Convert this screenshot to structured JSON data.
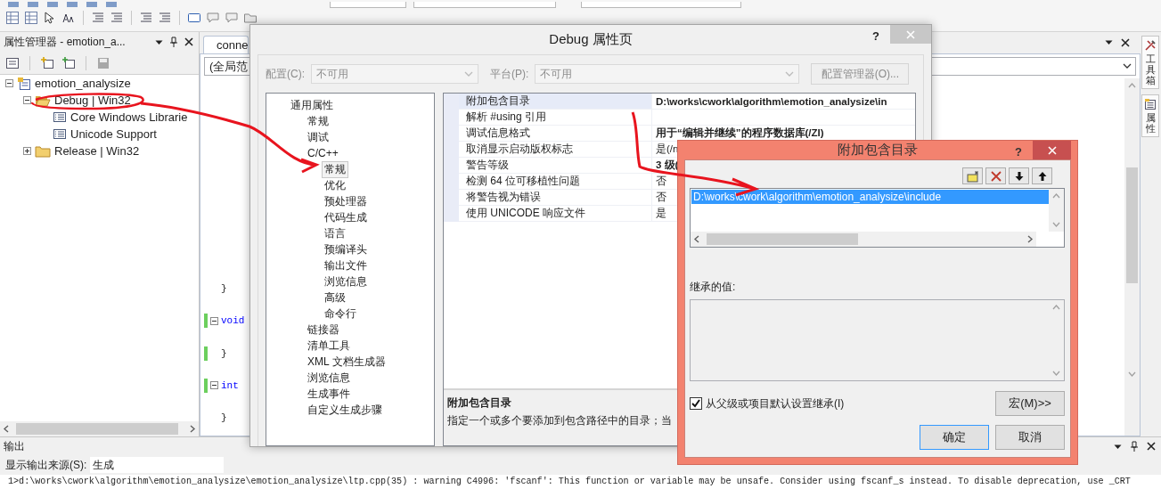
{
  "property_manager": {
    "title": "属性管理器 - emotion_a...",
    "tree": [
      {
        "label": "emotion_analysize",
        "kind": "project",
        "expanded": true,
        "children": [
          {
            "label": "Debug | Win32",
            "kind": "configuration",
            "expanded": true,
            "children": [
              {
                "label": "Core Windows Librarie",
                "kind": "sheet"
              },
              {
                "label": "Unicode Support",
                "kind": "sheet"
              }
            ]
          },
          {
            "label": "Release | Win32",
            "kind": "configuration",
            "expanded": false
          }
        ]
      }
    ]
  },
  "editor": {
    "tab": "conne",
    "scope": "(全局范",
    "code_lines": [
      {
        "text": "}",
        "kind": "brace",
        "modified": false
      },
      {
        "text": "void",
        "kind": "keyword",
        "modified": true
      },
      {
        "text": "}",
        "kind": "brace",
        "modified": true
      },
      {
        "text": "int",
        "kind": "keyword",
        "modified": true
      },
      {
        "text": "}",
        "kind": "brace",
        "modified": false
      }
    ]
  },
  "side_tabs": [
    {
      "label": "工具箱",
      "kind": "toolbox"
    },
    {
      "label": "属性",
      "kind": "properties"
    }
  ],
  "output": {
    "title": "输出",
    "source_label": "显示输出来源(S):",
    "source": "生成",
    "lines": [
      "1>d:\\works\\cwork\\algorithm\\emotion_analysize\\emotion_analysize\\ltp.cpp(35) : warning C4996: 'fscanf': This function or variable may be unsafe. Consider using fscanf_s instead. To disable deprecation, use _CRT"
    ]
  },
  "property_dialog": {
    "title": "Debug 属性页",
    "help": "?",
    "config_label": "配置(C):",
    "config": {
      "value": "不可用",
      "disabled": true
    },
    "platform_label": "平台(P):",
    "platform": {
      "value": "不可用",
      "disabled": true
    },
    "config_manager": {
      "label": "配置管理器(O)...",
      "disabled": true
    },
    "categories": [
      {
        "label": "通用属性",
        "selected": false,
        "children": [
          {
            "label": "常规",
            "selected": false
          },
          {
            "label": "调试",
            "selected": false
          },
          {
            "label": "C/C++",
            "selected": false,
            "children": [
              {
                "label": "常规",
                "selected": true
              },
              {
                "label": "优化",
                "selected": false
              },
              {
                "label": "预处理器",
                "selected": false
              },
              {
                "label": "代码生成",
                "selected": false
              },
              {
                "label": "语言",
                "selected": false
              },
              {
                "label": "预编译头",
                "selected": false
              },
              {
                "label": "输出文件",
                "selected": false
              },
              {
                "label": "浏览信息",
                "selected": false
              },
              {
                "label": "高级",
                "selected": false
              },
              {
                "label": "命令行",
                "selected": false
              }
            ]
          },
          {
            "label": "链接器",
            "selected": false
          },
          {
            "label": "清单工具",
            "selected": false
          },
          {
            "label": "XML 文档生成器",
            "selected": false
          },
          {
            "label": "浏览信息",
            "selected": false
          },
          {
            "label": "生成事件",
            "selected": false
          },
          {
            "label": "自定义生成步骤",
            "selected": false
          }
        ]
      }
    ],
    "properties": [
      {
        "name": "附加包含目录",
        "value": "D:\\works\\cwork\\algorithm\\emotion_analysize\\in",
        "modified": true,
        "selected": true
      },
      {
        "name": "解析 #using 引用",
        "selected": false
      },
      {
        "name": "调试信息格式",
        "value": "用于“编辑并继续”的程序数据库(/ZI)",
        "modified": true,
        "selected": false
      },
      {
        "name": "取消显示启动版权标志",
        "value": "是(/n",
        "modified": false,
        "selected": false
      },
      {
        "name": "警告等级",
        "value": "3 级(",
        "modified": true,
        "selected": false
      },
      {
        "name": "检测 64 位可移植性问题",
        "value": "否",
        "modified": false,
        "selected": false
      },
      {
        "name": "将警告视为错误",
        "value": "否",
        "modified": false,
        "selected": false
      },
      {
        "name": "使用 UNICODE 响应文件",
        "value": "是",
        "modified": false,
        "selected": false
      }
    ],
    "description": {
      "title": "附加包含目录",
      "text": "指定一个或多个要添加到包含路径中的目录；当"
    }
  },
  "include_dialog": {
    "title": "附加包含目录",
    "help": "?",
    "entries": [
      {
        "text": "D:\\works\\cwork\\algorithm\\emotion_analysize\\include",
        "selected": true
      }
    ],
    "inherited_label": "继承的值:",
    "inherit": {
      "label": "从父级或项目默认设置继承(I)",
      "checked": true
    },
    "macros": "宏(M)>>",
    "ok": "确定",
    "cancel": "取消"
  }
}
